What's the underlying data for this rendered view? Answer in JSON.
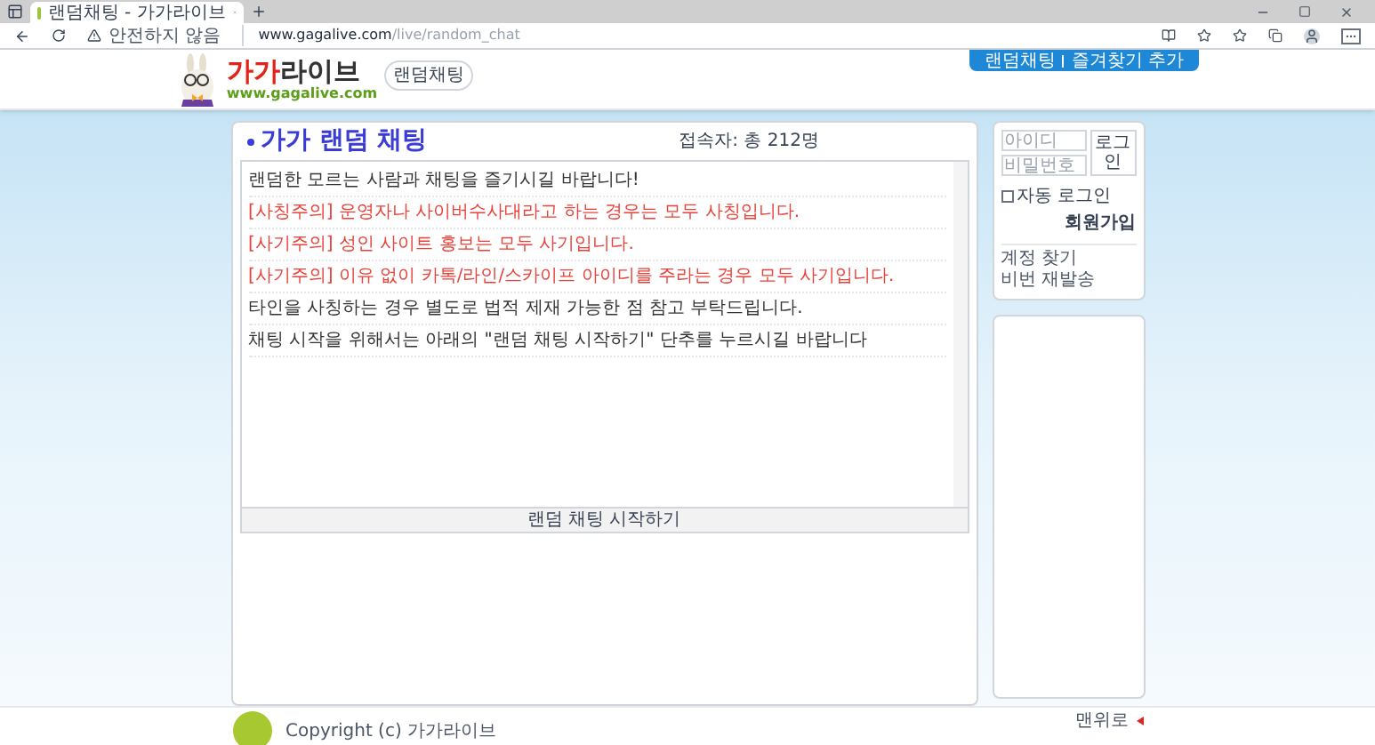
{
  "browser": {
    "tab_title": "랜덤채팅 - 가가라이브",
    "security_label": "안전하지 않음",
    "url_host": "www.gagalive.com",
    "url_path": "/live/random_chat"
  },
  "header": {
    "logo_accent": "가가",
    "logo_rest": "라이브",
    "logo_url": "www.gagalive.com",
    "logo_badge": "랜덤채팅",
    "top_links": [
      "랜덤채팅",
      "즐겨찾기 추가"
    ]
  },
  "chat": {
    "title": "가가 랜덤 채팅",
    "online_count": "접속자: 총 212명",
    "messages": [
      {
        "kind": "notice",
        "text": "랜덤한 모르는 사람과 채팅을 즐기시길 바랍니다!"
      },
      {
        "kind": "warning",
        "text": "[사칭주의] 운영자나 사이버수사대라고 하는 경우는 모두 사칭입니다."
      },
      {
        "kind": "warning",
        "text": "[사기주의] 성인 사이트 홍보는 모두 사기입니다."
      },
      {
        "kind": "warning",
        "text": "[사기주의] 이유 없이 카톡/라인/스카이프 아이디를 주라는 경우 모두 사기입니다."
      },
      {
        "kind": "notice",
        "text": "타인을 사칭하는 경우 별도로 법적 제재 가능한 점 참고 부탁드립니다."
      },
      {
        "kind": "notice",
        "text": "채팅 시작을 위해서는 아래의 \"랜덤 채팅 시작하기\" 단추를 누르시길 바랍니다"
      }
    ],
    "start_button": "랜덤 채팅 시작하기"
  },
  "login": {
    "id_placeholder": "아이디",
    "password_placeholder": "비밀번호",
    "login_button": "로그인",
    "auto_login": {
      "label": "자동 로그인",
      "checked": false
    },
    "signup": "회원가입",
    "links": [
      "계정 찾기",
      "비번 재발송"
    ]
  },
  "footer": {
    "copyright": "Copyright (c) 가가라이브",
    "top_link": "맨위로"
  }
}
